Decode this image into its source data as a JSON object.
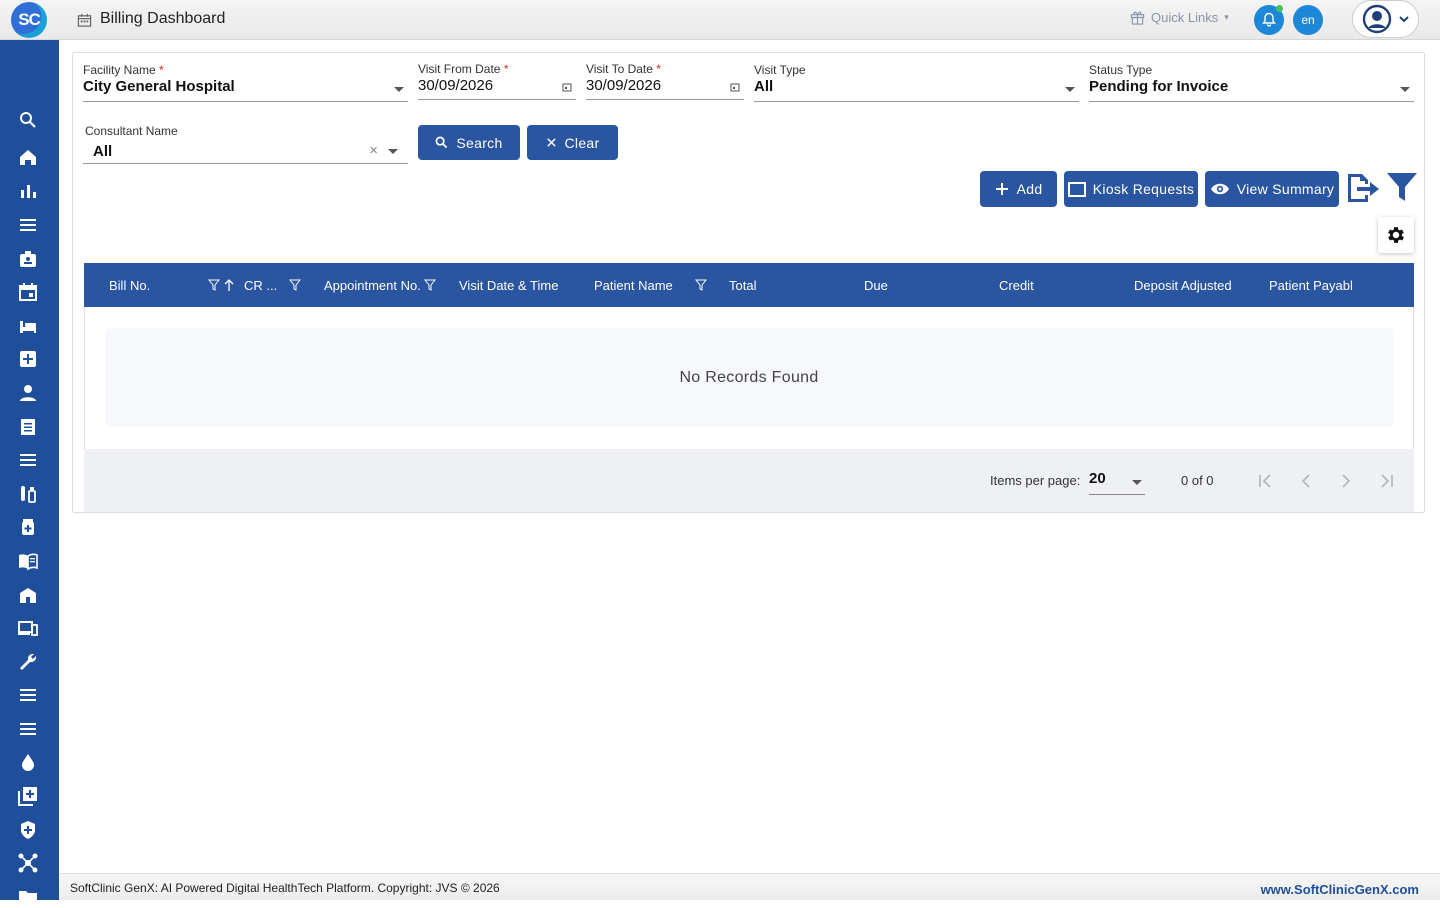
{
  "app": {
    "logo_text": "SC",
    "page_title": "Billing Dashboard",
    "quick_links": "Quick Links",
    "language": "en",
    "accent_color": "#2a55a0",
    "sidebar_color": "#1f4e9b"
  },
  "sidebar": {
    "items": [
      {
        "icon": "search-icon"
      },
      {
        "icon": "home-icon"
      },
      {
        "icon": "bar-chart-icon"
      },
      {
        "icon": "menu-icon"
      },
      {
        "icon": "id-badge-icon"
      },
      {
        "icon": "calendar-icon"
      },
      {
        "icon": "bed-icon"
      },
      {
        "icon": "medical-plus-icon"
      },
      {
        "icon": "person-icon"
      },
      {
        "icon": "receipt-icon"
      },
      {
        "icon": "list-icon"
      },
      {
        "icon": "lab-vials-icon"
      },
      {
        "icon": "medicine-icon"
      },
      {
        "icon": "book-icon"
      },
      {
        "icon": "hospital-icon"
      },
      {
        "icon": "devices-icon"
      },
      {
        "icon": "wrench-icon"
      },
      {
        "icon": "list-icon"
      },
      {
        "icon": "list-icon"
      },
      {
        "icon": "blood-drop-icon"
      },
      {
        "icon": "add-box-icon"
      },
      {
        "icon": "shield-icon"
      },
      {
        "icon": "network-icon"
      },
      {
        "icon": "folder-icon"
      }
    ]
  },
  "filters": {
    "facility": {
      "label": "Facility Name",
      "required": "*",
      "value": "City General Hospital"
    },
    "visit_from": {
      "label": "Visit From Date",
      "required": "*",
      "value": "30/09/2026"
    },
    "visit_to": {
      "label": "Visit To Date",
      "required": "*",
      "value": "30/09/2026"
    },
    "visit_type": {
      "label": "Visit Type",
      "value": "All"
    },
    "status_type": {
      "label": "Status Type",
      "value": "Pending for Invoice"
    },
    "consultant": {
      "label": "Consultant Name",
      "value": "All",
      "clear_glyph": "×"
    }
  },
  "actions": {
    "search": "Search",
    "clear": "Clear",
    "add": "Add",
    "kiosk_requests": "Kiosk Requests",
    "view_summary": "View Summary"
  },
  "table": {
    "columns": [
      "Bill No.",
      "CR ...",
      "Appointment No.",
      "Visit Date & Time",
      "Patient Name",
      "Total",
      "Due",
      "Credit",
      "Deposit Adjusted",
      "Patient Payabl"
    ],
    "empty_message": "No Records Found"
  },
  "paginator": {
    "items_per_page_label": "Items per page:",
    "items_per_page": "20",
    "range": "0 of 0"
  },
  "footer": {
    "copyright": "SoftClinic GenX: AI Powered Digital HealthTech Platform. Copyright: JVS © 2026",
    "website": "www.SoftClinicGenX.com"
  }
}
